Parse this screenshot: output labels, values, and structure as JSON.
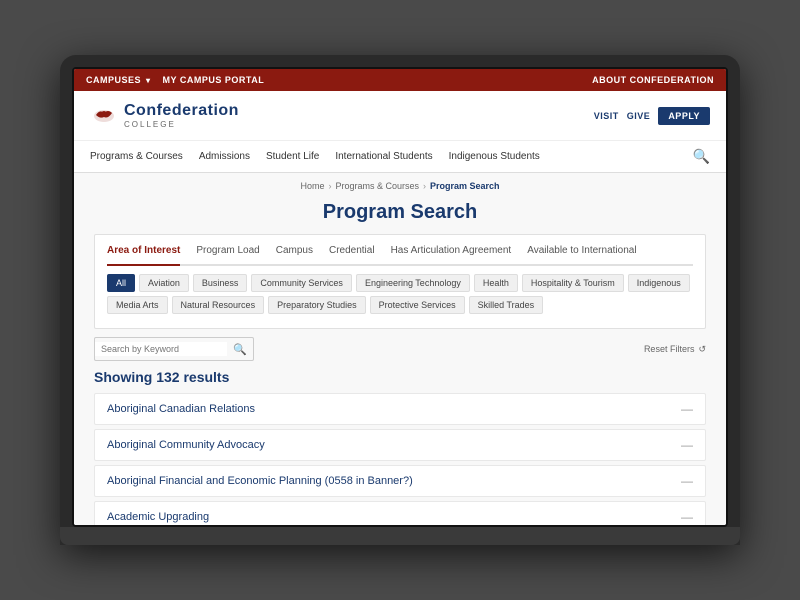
{
  "topBar": {
    "campuses": "CAMPUSES",
    "myPortal": "MY CAMPUS PORTAL",
    "aboutConfederation": "ABOUT CONFEDERATION"
  },
  "header": {
    "logoName": "Confederation",
    "logoCollege": "COLLEGE",
    "visitBtn": "VISIT",
    "giveBtn": "GIVE",
    "applyBtn": "APPLY"
  },
  "nav": {
    "items": [
      "Programs & Courses",
      "Admissions",
      "Student Life",
      "International Students",
      "Indigenous Students"
    ]
  },
  "breadcrumb": {
    "home": "Home",
    "programs": "Programs & Courses",
    "current": "Program Search"
  },
  "pageTitle": "Program Search",
  "filterTabs": [
    {
      "label": "Area of Interest",
      "active": true
    },
    {
      "label": "Program Load",
      "active": false
    },
    {
      "label": "Campus",
      "active": false
    },
    {
      "label": "Credential",
      "active": false
    },
    {
      "label": "Has Articulation Agreement",
      "active": false
    },
    {
      "label": "Available to International",
      "active": false
    }
  ],
  "categories": [
    {
      "label": "All",
      "active": true
    },
    {
      "label": "Aviation",
      "active": false
    },
    {
      "label": "Business",
      "active": false
    },
    {
      "label": "Community Services",
      "active": false
    },
    {
      "label": "Engineering Technology",
      "active": false
    },
    {
      "label": "Health",
      "active": false
    },
    {
      "label": "Hospitality & Tourism",
      "active": false
    },
    {
      "label": "Indigenous",
      "active": false
    },
    {
      "label": "Media Arts",
      "active": false
    },
    {
      "label": "Natural Resources",
      "active": false
    },
    {
      "label": "Preparatory Studies",
      "active": false
    },
    {
      "label": "Protective Services",
      "active": false
    },
    {
      "label": "Skilled Trades",
      "active": false
    }
  ],
  "search": {
    "placeholder": "Search by Keyword",
    "value": "",
    "resetLabel": "Reset Filters"
  },
  "results": {
    "count": "Showing 132 results",
    "items": [
      "Aboriginal Canadian Relations",
      "Aboriginal Community Advocacy",
      "Aboriginal Financial and Economic Planning (0558 in Banner?)",
      "Academic Upgrading"
    ]
  }
}
